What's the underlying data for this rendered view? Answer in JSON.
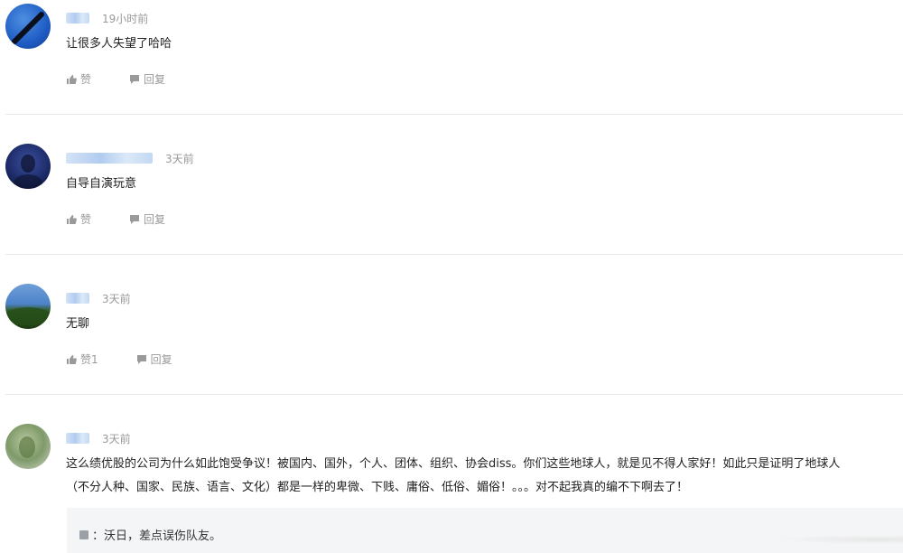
{
  "comments": [
    {
      "username": "",
      "time": "19小时前",
      "content": "让很多人失望了哈哈",
      "like_label": "赞",
      "reply_label": "回复"
    },
    {
      "username": "",
      "time": "3天前",
      "content": "自导自演玩意",
      "like_label": "赞",
      "reply_label": "回复"
    },
    {
      "username": "",
      "time": "3天前",
      "content": "无聊",
      "like_label": "赞1",
      "reply_label": "回复"
    },
    {
      "username": "",
      "time": "3天前",
      "content_line1": "这么绩优股的公司为什么如此饱受争议！被国内、国外，个人、团体、组织、协会diss。你们这些地球人，就是见不得人家好！如此只是证明了地球人",
      "content_line2": "（不分人种、国家、民族、语言、文化）都是一样的卑微、下贱、庸俗、低俗、媚俗！。。。对不起我真的编不下啊去了！",
      "reply": {
        "username": "",
        "text": "：沃日，差点误伤队友。"
      }
    }
  ],
  "icons": {
    "like": "thumbs-up-icon",
    "reply": "speech-bubble-icon"
  },
  "colors": {
    "meta_text": "#999999",
    "divider": "#e8e8e8",
    "reply_bg": "#f4f5f7"
  }
}
